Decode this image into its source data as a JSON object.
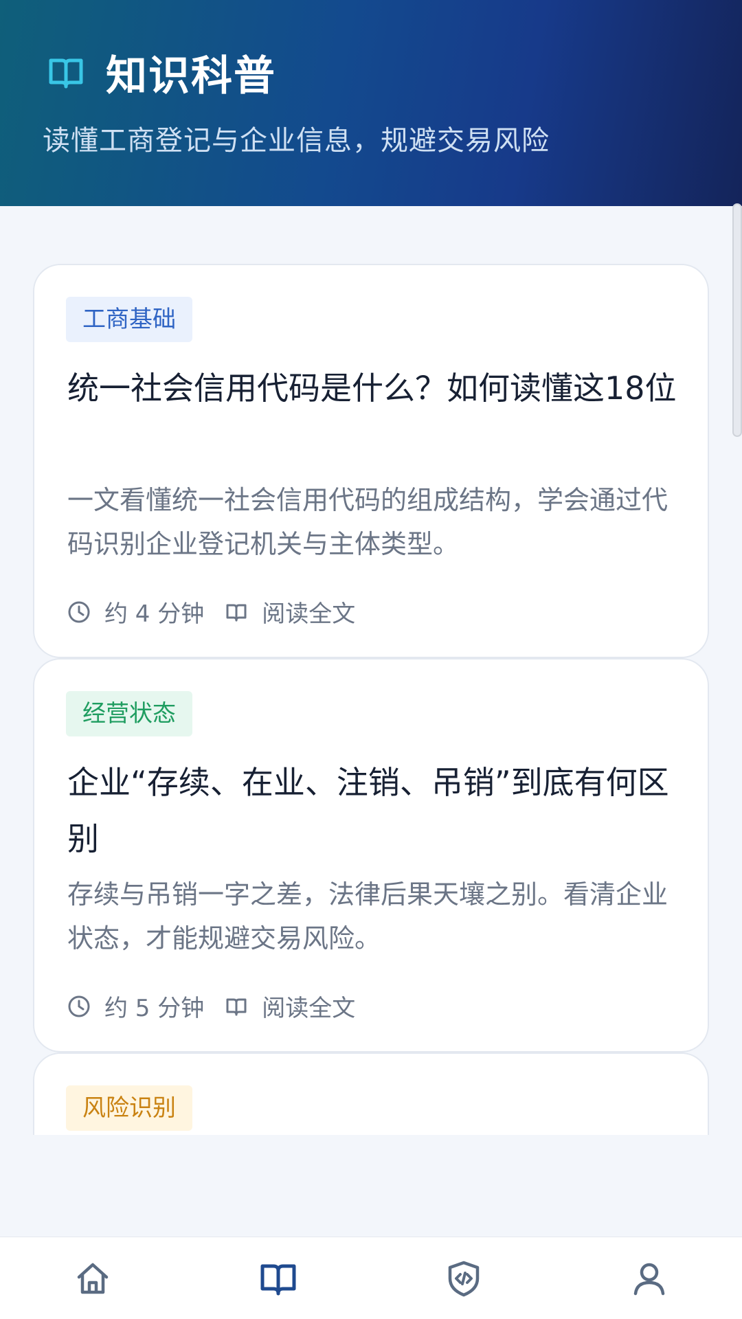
{
  "header": {
    "title": "知识科普",
    "subtitle": "读懂工商登记与企业信息，规避交易风险",
    "icon": "book-open-icon"
  },
  "articles": [
    {
      "tag": "工商基础",
      "tag_color": "#2f64c4",
      "title": "统一社会信用代码是什么？如何读懂这18位",
      "description": "一文看懂统一社会信用代码的组成结构，学会通过代码识别企业登记机关与主体类型。",
      "read_time": "约 4 分钟",
      "read_label": "阅读全文"
    },
    {
      "tag": "经营状态",
      "tag_color": "#1f9d60",
      "title": "企业“存续、在业、注销、吊销”到底有何区别",
      "description": "存续与吊销一字之差，法律后果天壤之别。看清企业状态，才能规避交易风险。",
      "read_time": "约 5 分钟",
      "read_label": "阅读全文"
    },
    {
      "tag": "风险识别",
      "tag_color": "#c98212"
    }
  ],
  "bottom_nav": [
    {
      "name": "home",
      "icon": "home-icon",
      "active": false
    },
    {
      "name": "knowledge",
      "icon": "book-open-icon",
      "active": true
    },
    {
      "name": "security",
      "icon": "shield-code-icon",
      "active": false
    },
    {
      "name": "profile",
      "icon": "user-icon",
      "active": false
    }
  ],
  "colors": {
    "accent": "#1f4a8f",
    "inactive_icon": "#5a6b82",
    "header_icon": "#39c6e6"
  }
}
